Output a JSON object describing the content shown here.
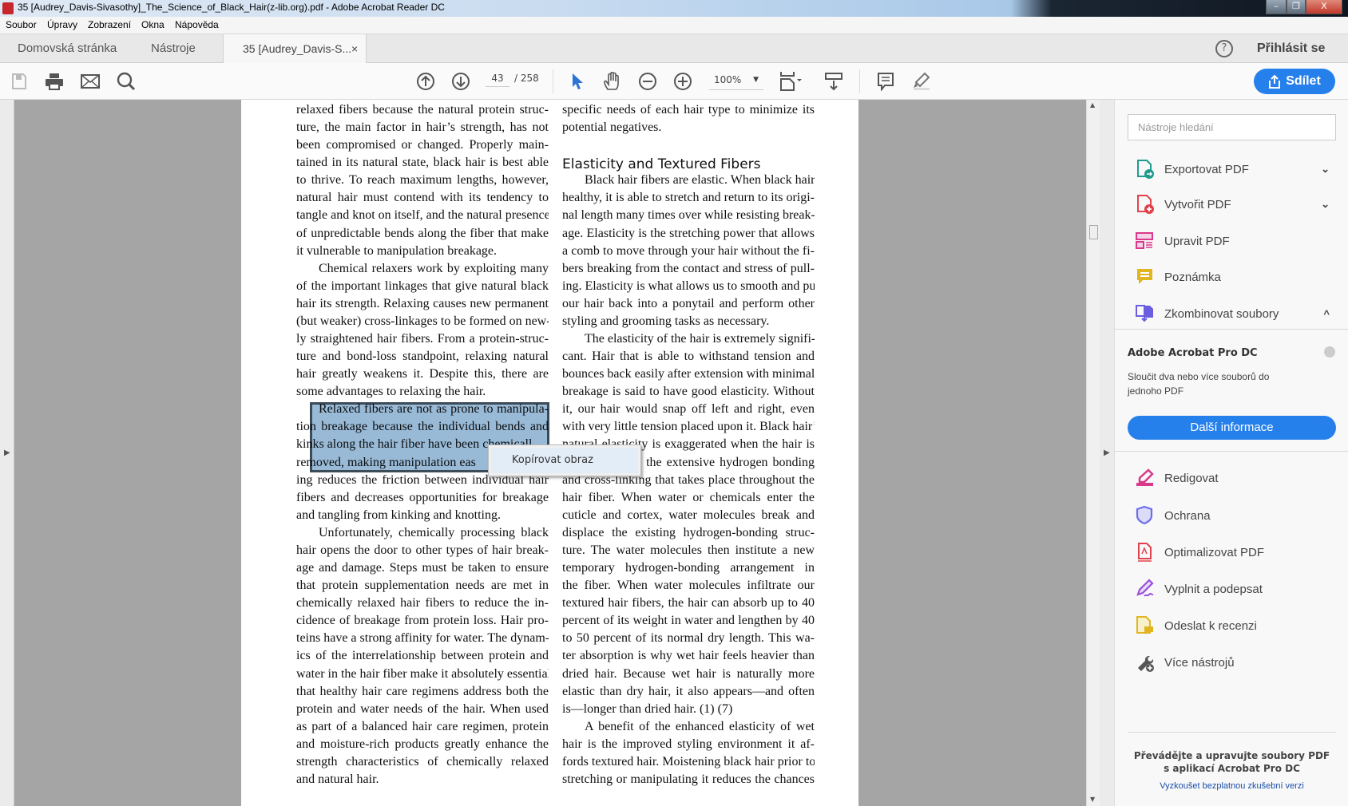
{
  "window": {
    "title": "35 [Audrey_Davis-Sivasothy]_The_Science_of_Black_Hair(z-lib.org).pdf - Adobe Acrobat Reader DC",
    "controls": [
      "minimize",
      "restore",
      "close"
    ]
  },
  "menu": [
    "Soubor",
    "Úpravy",
    "Zobrazení",
    "Okna",
    "Nápověda"
  ],
  "tabs": {
    "home": "Domovská stránka",
    "tools": "Nástroje",
    "document": "35 [Audrey_Davis-S...",
    "close": "×",
    "help": "?",
    "signin": "Přihlásit se"
  },
  "toolbar": {
    "page_current": "43",
    "page_total": "/ 258",
    "zoom": "100%",
    "share": "Sdílet",
    "icons": [
      "save-icon",
      "print-icon",
      "email-icon",
      "search-icon",
      "page-up-icon",
      "page-down-icon",
      "select-cursor-icon",
      "hand-icon",
      "zoom-out-icon",
      "zoom-in-icon",
      "fit-page-icon",
      "scroll-mode-icon",
      "comment-icon",
      "highlight-pen-icon"
    ],
    "accent": "#2680eb"
  },
  "document": {
    "col1": [
      {
        "t": "relaxed fibers because the natural protein struc-"
      },
      {
        "t": "ture, the main factor in hair’s strength, has not"
      },
      {
        "t": "been compromised or changed. Properly main-"
      },
      {
        "t": "tained in its natural state, black hair is best able"
      },
      {
        "t": "to thrive. To reach maximum lengths, however,"
      },
      {
        "t": "natural hair must contend with its tendency to"
      },
      {
        "t": "tangle and knot on itself, and the natural presence"
      },
      {
        "t": "of unpredictable bends along the fiber that make"
      },
      {
        "t": "it vulnerable to manipulation breakage.",
        "last": true
      },
      {
        "t": "Chemical relaxers work by exploiting many",
        "ind": true
      },
      {
        "t": "of the important linkages that give natural black"
      },
      {
        "t": "hair its strength. Relaxing causes new permanent"
      },
      {
        "t": "(but weaker) cross-linkages to be formed on new-"
      },
      {
        "t": "ly straightened hair fibers. From a protein-struc-"
      },
      {
        "t": "ture and bond-loss standpoint, relaxing natural"
      },
      {
        "t": "hair greatly weakens it. Despite this, there are"
      },
      {
        "t": "some advantages to relaxing the hair.",
        "last": true
      },
      {
        "t": "Relaxed fibers are not as prone to manipula-",
        "ind": true
      },
      {
        "t": "tion breakage because the individual bends and"
      },
      {
        "t": "kinks along the hair fiber have been chemicall",
        "last": true
      },
      {
        "t": "removed, making manipulation eas",
        "last": true
      },
      {
        "t": "ing reduces the friction between individual hair"
      },
      {
        "t": "fibers and decreases opportunities for breakage"
      },
      {
        "t": "and tangling from kinking and knotting.",
        "last": true
      },
      {
        "t": "Unfortunately, chemically processing black",
        "ind": true
      },
      {
        "t": "hair opens the door to other types of hair break-"
      },
      {
        "t": "age and damage. Steps must be taken to ensure"
      },
      {
        "t": "that protein supplementation needs are met in"
      },
      {
        "t": "chemically relaxed hair fibers to reduce the in-"
      },
      {
        "t": "cidence of breakage from protein loss. Hair pro-"
      },
      {
        "t": "teins have a strong affinity for water. The dynam-"
      },
      {
        "t": "ics of the interrelationship between protein and"
      },
      {
        "t": "water in the hair fiber make it absolutely essential"
      },
      {
        "t": "that healthy hair care regimens address both the"
      },
      {
        "t": "protein and water needs of the hair. When used"
      },
      {
        "t": "as part of a balanced hair care regimen, protein"
      },
      {
        "t": "and moisture-rich products greatly enhance the"
      },
      {
        "t": "strength characteristics of chemically relaxed"
      },
      {
        "t": "and natural hair.",
        "last": true
      }
    ],
    "col2": [
      {
        "t": "specific needs of each hair type to minimize its"
      },
      {
        "t": "potential negatives.",
        "last": true
      },
      {
        "t": "",
        "last": true
      },
      {
        "t": "Elasticity and Textured Fibers",
        "h": true
      },
      {
        "t": "Black hair fibers are elastic. When black hair is",
        "ind": true
      },
      {
        "t": "healthy, it is able to stretch and return to its origi-"
      },
      {
        "t": "nal length many times over while resisting break-"
      },
      {
        "t": "age. Elasticity is the stretching power that allows"
      },
      {
        "t": "a comb to move through your hair without the fi-"
      },
      {
        "t": "bers breaking from the contact and stress of pull-"
      },
      {
        "t": "ing. Elasticity is what allows us to smooth and pull"
      },
      {
        "t": "our hair back into a ponytail and perform other"
      },
      {
        "t": "styling and grooming tasks as necessary.",
        "last": true
      },
      {
        "t": "The elasticity of the hair is extremely signifi-",
        "ind": true
      },
      {
        "t": "cant. Hair that is able to withstand tension and"
      },
      {
        "t": "bounces back easily after extension with minimal"
      },
      {
        "t": "breakage is said to have good elasticity. Without"
      },
      {
        "t": "it, our hair would snap off left and right, even"
      },
      {
        "t": "with very little tension placed upon it. Black hair’s"
      },
      {
        "t": "natural elasticity is exaggerated when the hair is"
      },
      {
        "t": "wet because of the extensive hydrogen bonding"
      },
      {
        "t": "and cross-linking that takes place throughout the"
      },
      {
        "t": "hair fiber. When water or chemicals enter the"
      },
      {
        "t": "cuticle and cortex, water molecules break and"
      },
      {
        "t": "displace the existing hydrogen-bonding struc-"
      },
      {
        "t": "ture. The water molecules then institute a new"
      },
      {
        "t": "temporary hydrogen-bonding arrangement in"
      },
      {
        "t": "the fiber. When water molecules infiltrate our"
      },
      {
        "t": "textured hair fibers, the hair can absorb up to 40"
      },
      {
        "t": "percent of its weight in water and lengthen by 40"
      },
      {
        "t": "to 50 percent of its normal dry length. This wa-"
      },
      {
        "t": "ter absorption is why wet hair feels heavier than"
      },
      {
        "t": "dried hair. Because wet hair is naturally more"
      },
      {
        "t": "elastic than dry hair, it also appears—and often"
      },
      {
        "t": "is—longer than dried hair. (1) (7)",
        "last": true
      },
      {
        "t": "A benefit of the enhanced elasticity of wet",
        "ind": true
      },
      {
        "t": "hair is the improved styling environment it af-"
      },
      {
        "t": "fords textured hair. Moistening black hair prior to"
      },
      {
        "t": "stretching or manipulating it reduces the chances"
      }
    ]
  },
  "context_menu": {
    "item": "Kopírovat obraz"
  },
  "panel": {
    "search_placeholder": "Nástroje hledání",
    "tools_top": [
      {
        "label": "Exportovat PDF",
        "icon": "export-pdf-icon",
        "color": "#1e9a8e",
        "chevron": "⌄"
      },
      {
        "label": "Vytvořit PDF",
        "icon": "create-pdf-icon",
        "color": "#e0424b",
        "chevron": "⌄"
      },
      {
        "label": "Upravit PDF",
        "icon": "edit-pdf-icon",
        "color": "#d8398b"
      },
      {
        "label": "Poznámka",
        "icon": "comment-icon",
        "color": "#e0b520"
      },
      {
        "label": "Zkombinovat soubory",
        "icon": "combine-files-icon",
        "color": "#6b5de0",
        "chevron": "^"
      }
    ],
    "promo": {
      "title": "Adobe Acrobat Pro DC",
      "desc1": "Sloučit dva nebo více souborů do",
      "desc2": "jednoho PDF",
      "button": "Další informace"
    },
    "tools_bottom": [
      {
        "label": "Redigovat",
        "icon": "redact-icon",
        "color": "#d8398b"
      },
      {
        "label": "Ochrana",
        "icon": "shield-icon",
        "color": "#6b6ee8"
      },
      {
        "label": "Optimalizovat PDF",
        "icon": "optimize-pdf-icon",
        "color": "#e0424b"
      },
      {
        "label": "Vyplnit a podepsat",
        "icon": "fill-sign-icon",
        "color": "#9a4fd8"
      },
      {
        "label": "Odeslat k recenzi",
        "icon": "send-review-icon",
        "color": "#e0b520"
      },
      {
        "label": "Více nástrojů",
        "icon": "more-tools-icon",
        "color": "#555555"
      }
    ],
    "footer": {
      "line1": "Převádějte a upravujte soubory PDF",
      "line2": "s aplikací Acrobat Pro DC",
      "link": "Vyzkoušet bezplatnou zkušební verzi"
    }
  }
}
